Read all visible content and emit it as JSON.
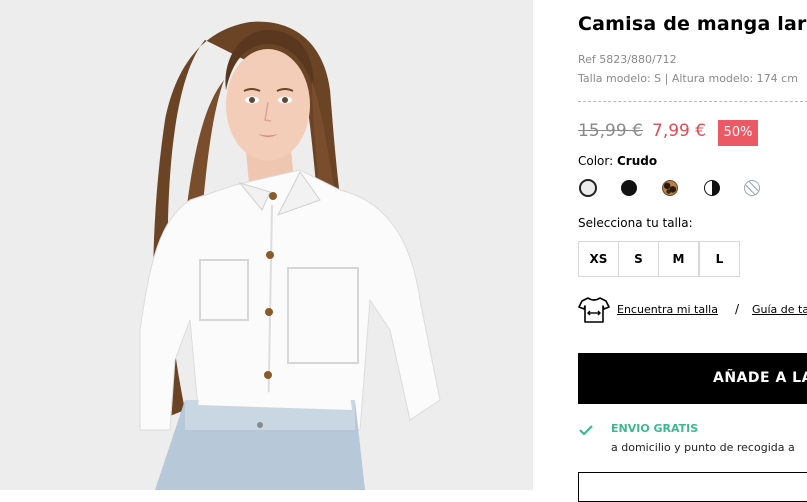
{
  "product": {
    "title": "Camisa de manga larga",
    "ref": "Ref 5823/880/712",
    "model_info": "Talla modelo: S | Altura modelo: 174 cm",
    "image_alt": "model-wearing-white-shirt"
  },
  "price": {
    "old": "15,99 €",
    "new": "7,99 €",
    "discount": "50%"
  },
  "color": {
    "label": "Color:",
    "selected": "Crudo",
    "swatches": [
      "crudo",
      "negro",
      "leopardo",
      "blanco-negro",
      "estampado"
    ]
  },
  "sizes": {
    "label": "Selecciona tu talla:",
    "options": [
      "XS",
      "S",
      "M",
      "L"
    ]
  },
  "size_help": {
    "find_size": "Encuentra mi talla",
    "separator": "/",
    "size_guide": "Guía de ta"
  },
  "cta": {
    "add_to_cart": "AÑADE A LA C"
  },
  "shipping": {
    "title": "ENVIO GRATIS",
    "description": "a domicilio y punto de recogida a"
  },
  "colors": {
    "sale_red": "#e24a55",
    "badge_red": "#ea5964",
    "ship_green": "#3cb88f",
    "photo_bg": "#ededed"
  }
}
